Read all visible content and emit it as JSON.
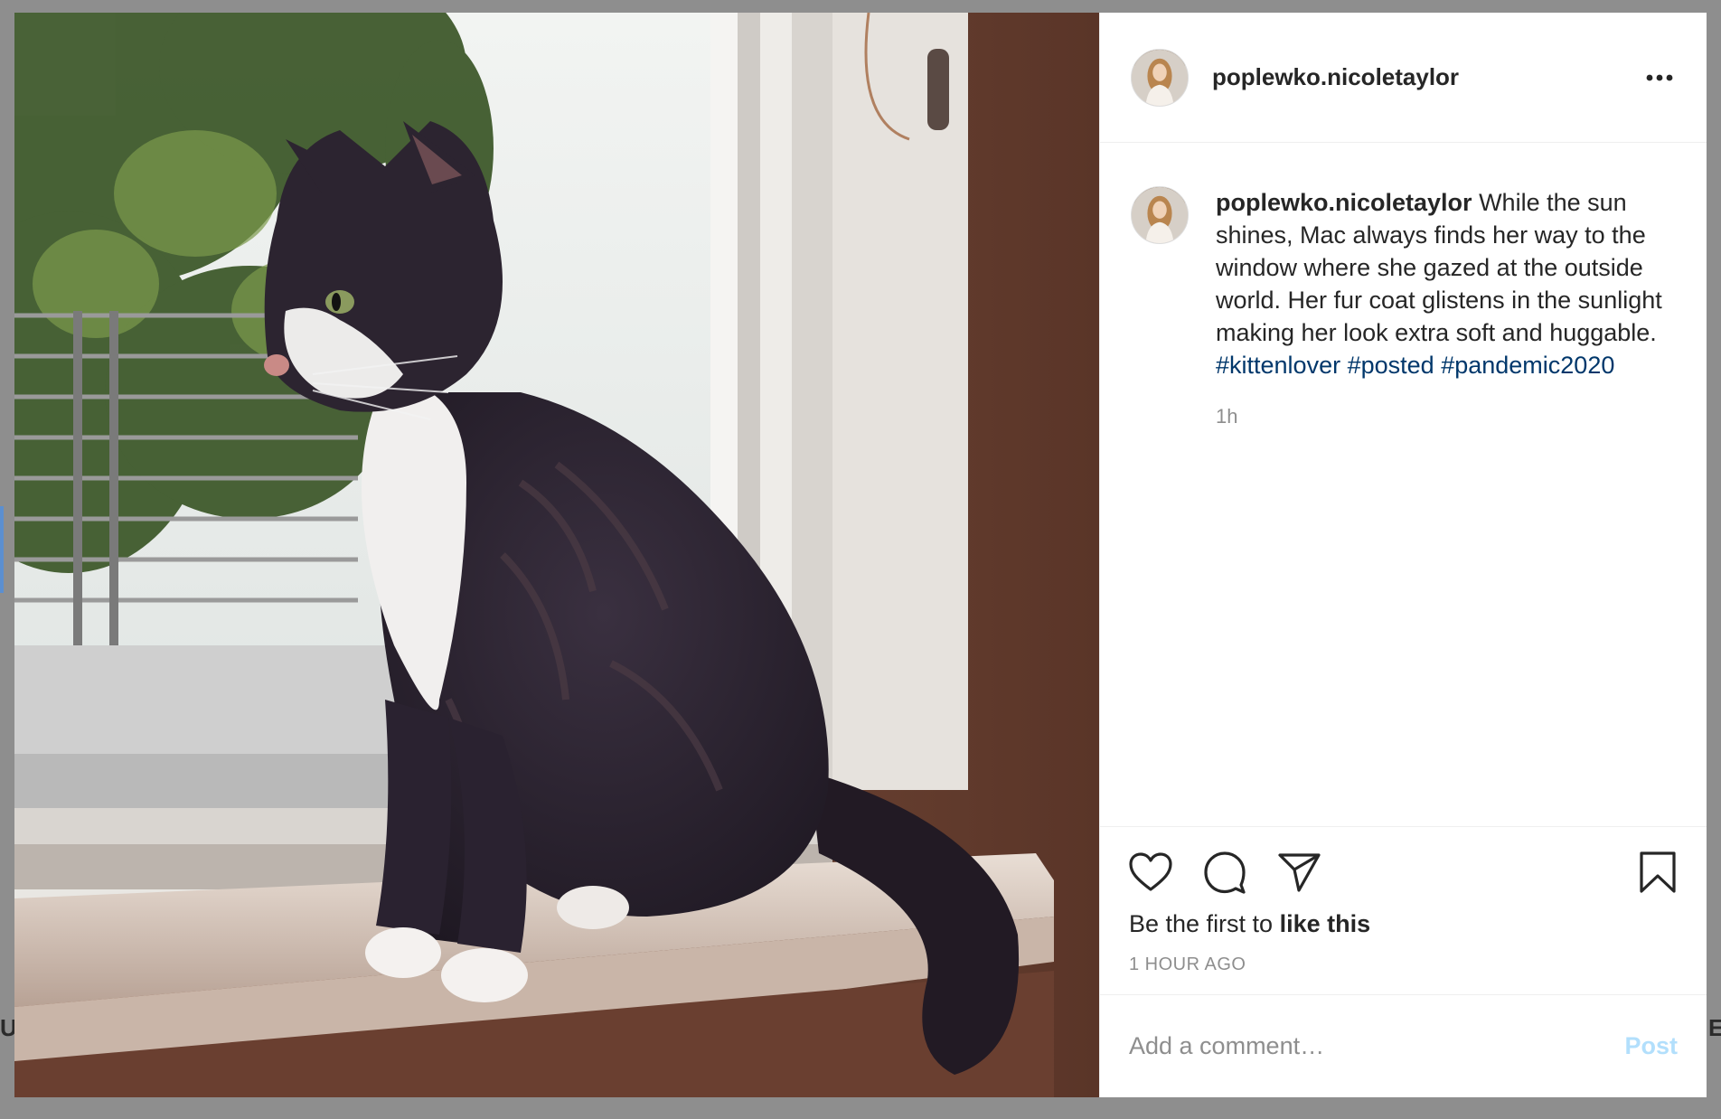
{
  "backdrop": {
    "left_peek": "U",
    "right_peek": "E"
  },
  "photo": {
    "alt": "Tabby cat with white chest sitting on a windowsill looking outside"
  },
  "header": {
    "username": "poplewko.nicoletaylor",
    "more_icon": "more-horizontal-icon"
  },
  "caption": {
    "username": "poplewko.nicoletaylor",
    "text": "While the sun shines, Mac always finds her way to the window where she gazed at the outside world. Her fur coat glistens in the sunlight making her look extra soft and huggable.",
    "hashtags": [
      "#kittenlover",
      "#posted",
      "#pandemic2020"
    ],
    "time_ago": "1h"
  },
  "actions": {
    "like_icon": "heart-icon",
    "comment_icon": "comment-icon",
    "share_icon": "share-icon",
    "save_icon": "bookmark-icon"
  },
  "likes": {
    "prefix": "Be the first to",
    "emphasis": "like this"
  },
  "timestamp": "1 HOUR AGO",
  "comment": {
    "placeholder": "Add a comment…",
    "post_label": "Post"
  },
  "colors": {
    "text": "#262626",
    "secondary": "#8e8e8e",
    "hashtag": "#00376b",
    "post_disabled": "#b2dffc",
    "backdrop": "#8e8e8e"
  }
}
